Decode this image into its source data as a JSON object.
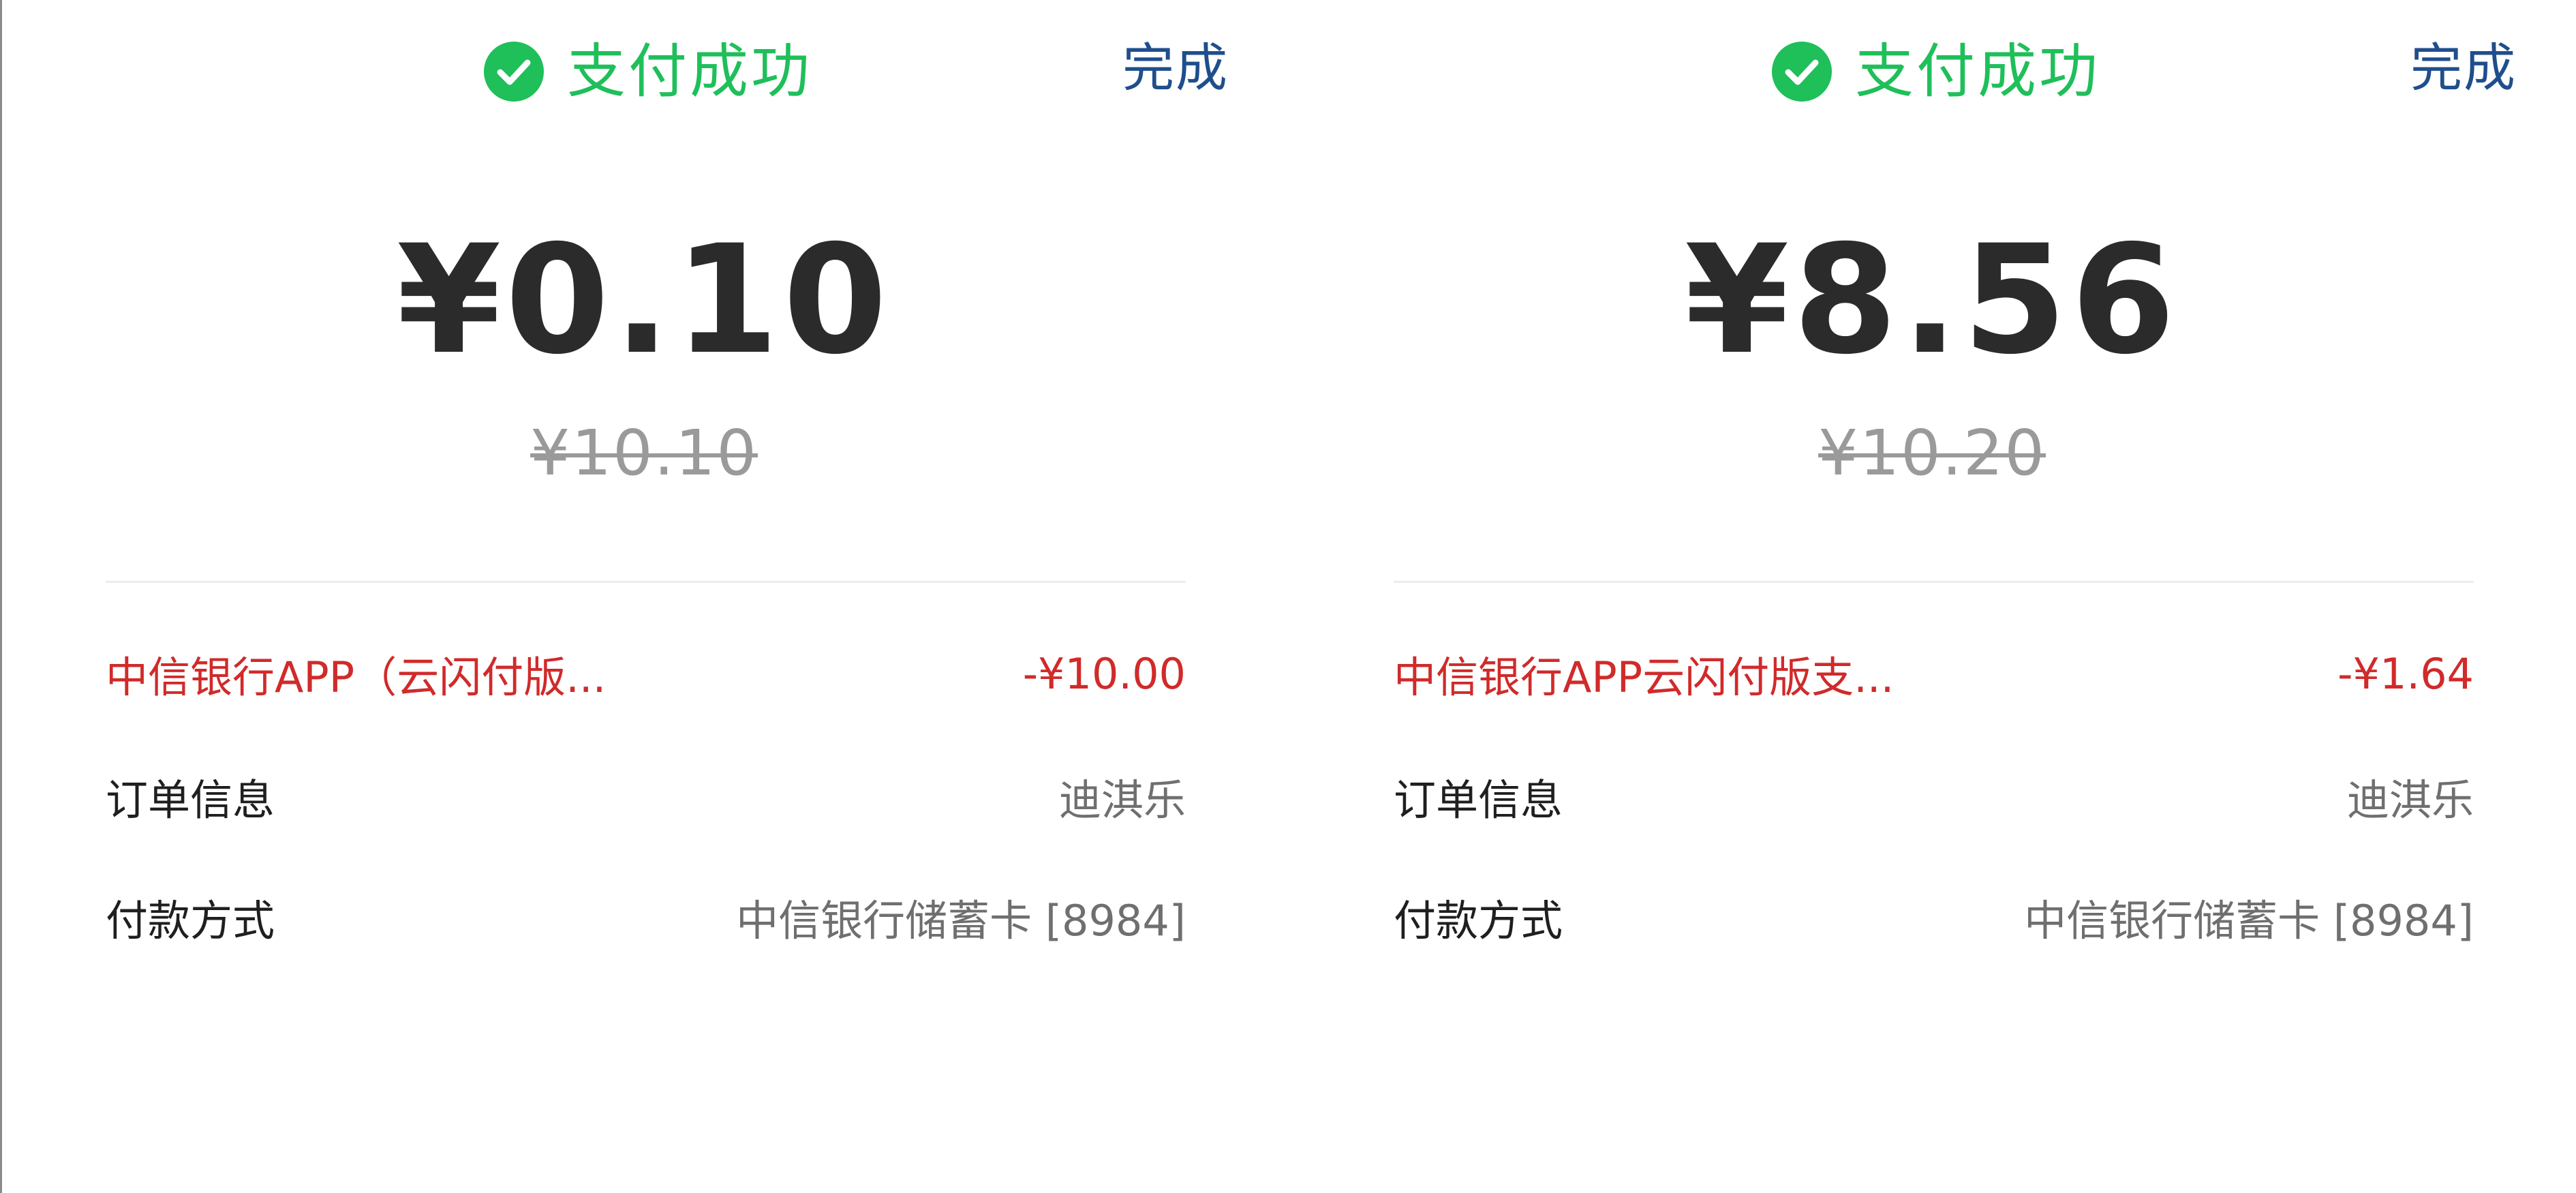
{
  "panels": [
    {
      "status_text": "支付成功",
      "done_label": "完成",
      "amount": "¥0.10",
      "original_amount": "¥10.10",
      "discount": {
        "label": "中信银行APP（云闪付版...",
        "value": "-¥10.00"
      },
      "order": {
        "label": "订单信息",
        "value": "迪淇乐"
      },
      "payment": {
        "label": "付款方式",
        "value": "中信银行储蓄卡 [8984]"
      }
    },
    {
      "status_text": "支付成功",
      "done_label": "完成",
      "amount": "¥8.56",
      "original_amount": "¥10.20",
      "discount": {
        "label": "中信银行APP云闪付版支...",
        "value": "-¥1.64"
      },
      "order": {
        "label": "订单信息",
        "value": "迪淇乐"
      },
      "payment": {
        "label": "付款方式",
        "value": "中信银行储蓄卡 [8984]"
      }
    }
  ],
  "colors": {
    "success_green": "#1fbf5a",
    "link_blue": "#1f4e8c",
    "discount_red": "#d12a2a",
    "amount_text": "#2b2b2b",
    "muted_gray": "#9a9a9a"
  },
  "icons": {
    "status": "check-circle-icon"
  }
}
